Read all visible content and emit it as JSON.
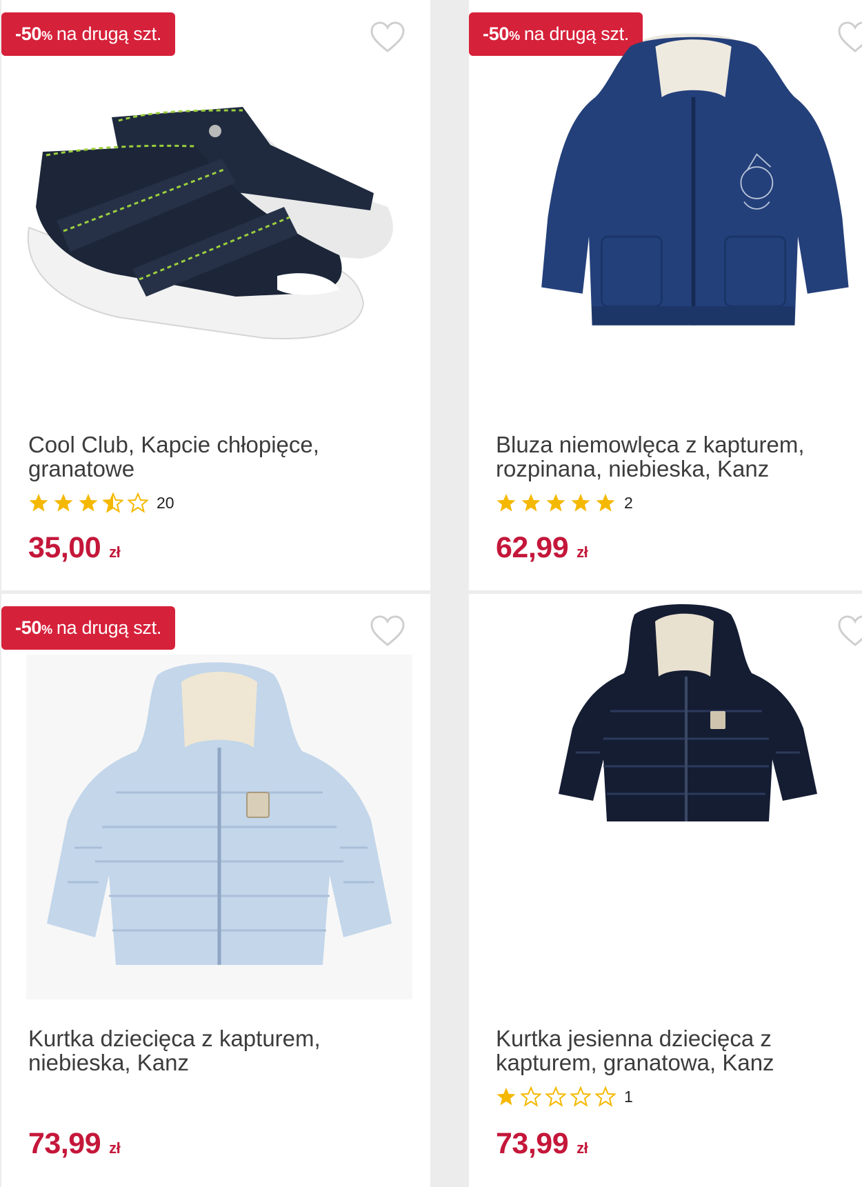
{
  "products": [
    {
      "badge": {
        "pct": "-50",
        "pct_sign": "%",
        "text": "na drugą szt."
      },
      "title": "Cool Club, Kapcie chłopięce, granatowe",
      "rating": {
        "value": 3.5,
        "count": "20"
      },
      "price": {
        "amount": "35,00",
        "currency": "zł"
      },
      "image_icon": "sandals-image"
    },
    {
      "badge": {
        "pct": "-50",
        "pct_sign": "%",
        "text": "na drugą szt."
      },
      "title": "Bluza niemowlęca z kapturem, rozpinana, niebieska, Kanz",
      "rating": {
        "value": 5,
        "count": "2"
      },
      "price": {
        "amount": "62,99",
        "currency": "zł"
      },
      "image_icon": "hoodie-image"
    },
    {
      "badge": {
        "pct": "-50",
        "pct_sign": "%",
        "text": "na drugą szt."
      },
      "title": "Kurtka dziecięca z kapturem, niebieska, Kanz",
      "rating": null,
      "price": {
        "amount": "73,99",
        "currency": "zł"
      },
      "image_icon": "light-blue-puffer-jacket-image"
    },
    {
      "badge": null,
      "title": "Kurtka jesienna dziecięca z kapturem, granatowa, Kanz",
      "rating": {
        "value": 1,
        "count": "1"
      },
      "price": {
        "amount": "73,99",
        "currency": "zł"
      },
      "image_icon": "navy-puffer-jacket-image"
    }
  ],
  "colors": {
    "badge_bg": "#d6213a",
    "price": "#c4173a",
    "star": "#f5b800",
    "heart_outline": "#cfcfcf"
  }
}
